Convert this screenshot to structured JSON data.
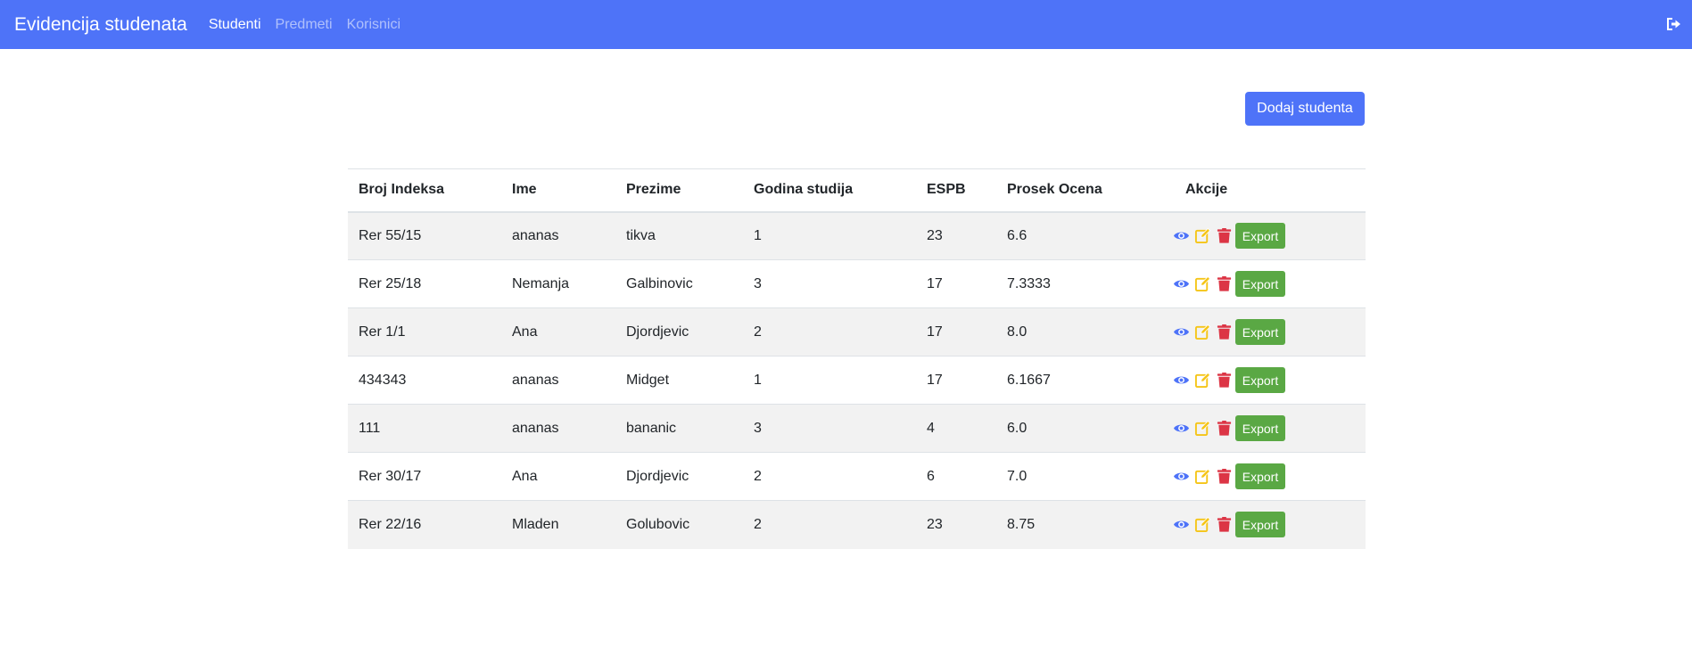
{
  "navbar": {
    "brand": "Evidencija studenata",
    "links": [
      {
        "label": "Studenti",
        "active": true
      },
      {
        "label": "Predmeti",
        "active": false
      },
      {
        "label": "Korisnici",
        "active": false
      }
    ],
    "logout_icon": "sign-out-icon"
  },
  "toolbar": {
    "add_student_label": "Dodaj studenta"
  },
  "table": {
    "columns": [
      "Broj Indeksa",
      "Ime",
      "Prezime",
      "Godina studija",
      "ESPB",
      "Prosek Ocena",
      "Akcije"
    ],
    "rows": [
      {
        "index": "Rer 55/15",
        "ime": "ananas",
        "prezime": "tikva",
        "godina": "1",
        "espb": "23",
        "prosek": "6.6"
      },
      {
        "index": "Rer 25/18",
        "ime": "Nemanja",
        "prezime": "Galbinovic",
        "godina": "3",
        "espb": "17",
        "prosek": "7.3333"
      },
      {
        "index": "Rer 1/1",
        "ime": "Ana",
        "prezime": "Djordjevic",
        "godina": "2",
        "espb": "17",
        "prosek": "8.0"
      },
      {
        "index": "434343",
        "ime": "ananas",
        "prezime": "Midget",
        "godina": "1",
        "espb": "17",
        "prosek": "6.1667"
      },
      {
        "index": "111",
        "ime": "ananas",
        "prezime": "bananic",
        "godina": "3",
        "espb": "4",
        "prosek": "6.0"
      },
      {
        "index": "Rer 30/17",
        "ime": "Ana",
        "prezime": "Djordjevic",
        "godina": "2",
        "espb": "6",
        "prosek": "7.0"
      },
      {
        "index": "Rer 22/16",
        "ime": "Mladen",
        "prezime": "Golubovic",
        "godina": "2",
        "espb": "23",
        "prosek": "8.75"
      }
    ],
    "actions": {
      "view_icon": "eye-icon",
      "edit_icon": "edit-icon",
      "delete_icon": "trash-icon",
      "export_label": "Export"
    }
  },
  "colors": {
    "primary": "#4e73f8",
    "view": "#4e73f8",
    "edit": "#f5c518",
    "delete": "#dc3545",
    "export": "#5aa844",
    "stripe": "#f2f2f2"
  }
}
